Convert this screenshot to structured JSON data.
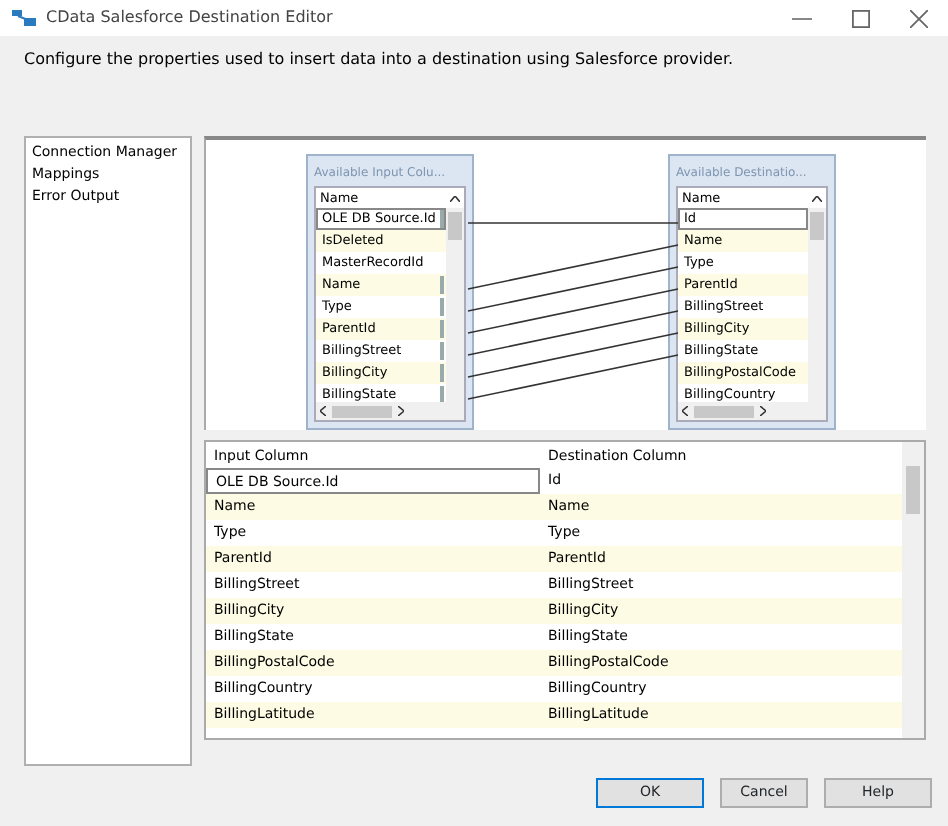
{
  "window": {
    "title": "CData Salesforce Destination Editor"
  },
  "description": "Configure the properties used to insert data into a destination using Salesforce provider.",
  "sidebar": {
    "items": [
      {
        "label": "Connection Manager"
      },
      {
        "label": "Mappings"
      },
      {
        "label": "Error Output"
      }
    ]
  },
  "mapping_diagram": {
    "input_list": {
      "title": "Available Input Colu...",
      "header": "Name",
      "items": [
        {
          "label": "OLE DB Source.Id",
          "selected": true,
          "mapped": true
        },
        {
          "label": "IsDeleted",
          "selected": false,
          "mapped": false
        },
        {
          "label": "MasterRecordId",
          "selected": false,
          "mapped": false
        },
        {
          "label": "Name",
          "selected": false,
          "mapped": true
        },
        {
          "label": "Type",
          "selected": false,
          "mapped": true
        },
        {
          "label": "ParentId",
          "selected": false,
          "mapped": true
        },
        {
          "label": "BillingStreet",
          "selected": false,
          "mapped": true
        },
        {
          "label": "BillingCity",
          "selected": false,
          "mapped": true
        },
        {
          "label": "BillingState",
          "selected": false,
          "mapped": true
        }
      ]
    },
    "destination_list": {
      "title": "Available Destinatio...",
      "header": "Name",
      "items": [
        {
          "label": "Id",
          "selected": true
        },
        {
          "label": "Name",
          "selected": false
        },
        {
          "label": "Type",
          "selected": false
        },
        {
          "label": "ParentId",
          "selected": false
        },
        {
          "label": "BillingStreet",
          "selected": false
        },
        {
          "label": "BillingCity",
          "selected": false
        },
        {
          "label": "BillingState",
          "selected": false
        },
        {
          "label": "BillingPostalCode",
          "selected": false
        },
        {
          "label": "BillingCountry",
          "selected": false
        }
      ]
    }
  },
  "table": {
    "columns": [
      "Input Column",
      "Destination Column"
    ],
    "rows": [
      {
        "cells": [
          "OLE DB Source.Id",
          "Id"
        ],
        "selected": true
      },
      {
        "cells": [
          "Name",
          "Name"
        ],
        "selected": false
      },
      {
        "cells": [
          "Type",
          "Type"
        ],
        "selected": false
      },
      {
        "cells": [
          "ParentId",
          "ParentId"
        ],
        "selected": false
      },
      {
        "cells": [
          "BillingStreet",
          "BillingStreet"
        ],
        "selected": false
      },
      {
        "cells": [
          "BillingCity",
          "BillingCity"
        ],
        "selected": false
      },
      {
        "cells": [
          "BillingState",
          "BillingState"
        ],
        "selected": false
      },
      {
        "cells": [
          "BillingPostalCode",
          "BillingPostalCode"
        ],
        "selected": false
      },
      {
        "cells": [
          "BillingCountry",
          "BillingCountry"
        ],
        "selected": false
      },
      {
        "cells": [
          "BillingLatitude",
          "BillingLatitude"
        ],
        "selected": false
      }
    ]
  },
  "buttons": [
    {
      "label": "OK",
      "default": true
    },
    {
      "label": "Cancel",
      "default": false
    },
    {
      "label": "Help",
      "default": false
    }
  ]
}
